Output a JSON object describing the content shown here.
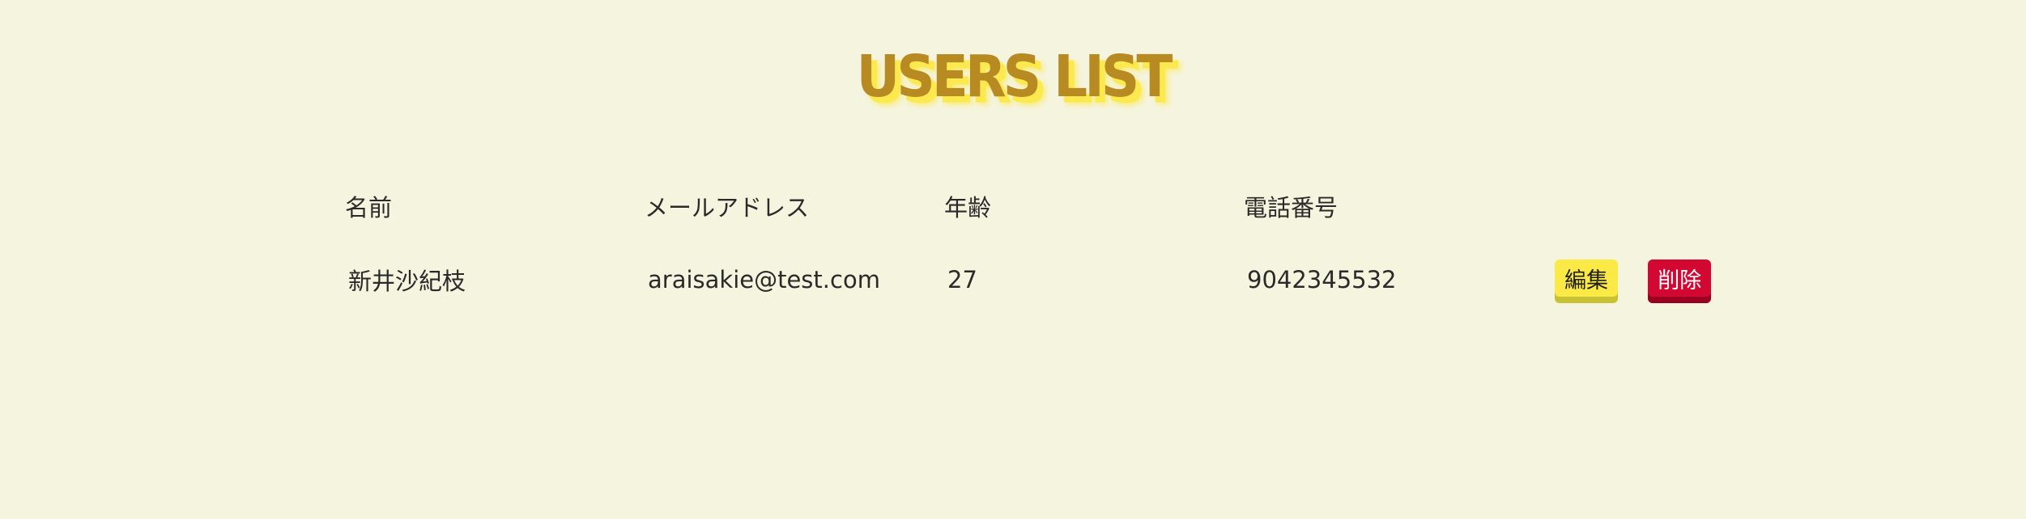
{
  "page": {
    "title": "USERS LIST"
  },
  "table": {
    "headers": {
      "name": "名前",
      "email": "メールアドレス",
      "age": "年齢",
      "phone": "電話番号"
    },
    "rows": [
      {
        "name": "新井沙紀枝",
        "email": "araisakie@test.com",
        "age": "27",
        "phone": "9042345532",
        "edit_label": "編集",
        "delete_label": "削除"
      }
    ]
  },
  "colors": {
    "background": "#f5f4de",
    "title": "#b78a22",
    "title_shadow": "#fbe94f",
    "edit_button": "#fbe946",
    "delete_button": "#d20832"
  }
}
